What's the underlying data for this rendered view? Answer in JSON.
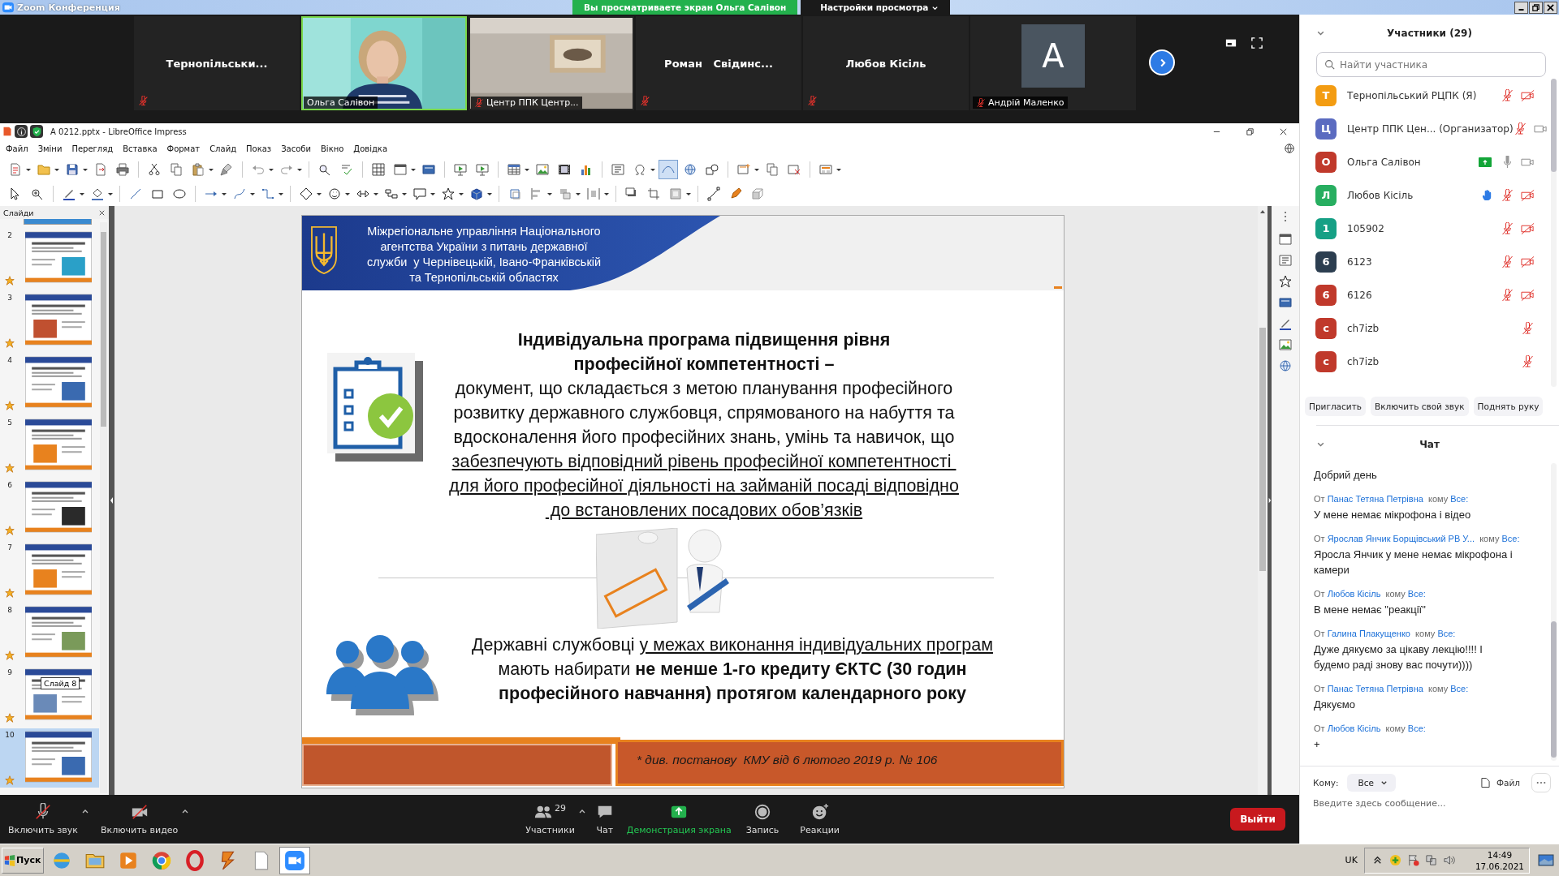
{
  "window": {
    "title": "Zoom Конференция"
  },
  "share_banner": {
    "text": "Вы просматриваете экран Ольга Салівон"
  },
  "view_options": {
    "label": "Настройки просмотра"
  },
  "video_tiles": [
    {
      "kind": "name",
      "name": "Тернопільськи...",
      "muted": true,
      "speaking": false
    },
    {
      "kind": "video",
      "name": "Ольга Салівон",
      "muted": false,
      "speaking": true
    },
    {
      "kind": "video",
      "name": "Центр ППК Центр...",
      "muted": true,
      "speaking": false
    },
    {
      "kind": "name",
      "name": "Роман   Свідинс...",
      "muted": true,
      "speaking": false
    },
    {
      "kind": "name",
      "name": "Любов Кісіль",
      "muted": true,
      "speaking": false
    },
    {
      "kind": "avatar",
      "name": "Андрій Маленко",
      "initial": "A",
      "muted": true,
      "speaking": false
    }
  ],
  "impress": {
    "title": "А 0212.pptx - LibreOffice Impress",
    "menu": [
      "Файл",
      "Зміни",
      "Перегляд",
      "Вставка",
      "Формат",
      "Слайд",
      "Показ",
      "Засоби",
      "Вікно",
      "Довідка"
    ],
    "slides_panel": {
      "title": "Слайди",
      "tooltip": "Слайд 8",
      "slides": [
        {
          "number": "2",
          "selected": false
        },
        {
          "number": "3",
          "selected": false
        },
        {
          "number": "4",
          "selected": false
        },
        {
          "number": "5",
          "selected": false
        },
        {
          "number": "6",
          "selected": false
        },
        {
          "number": "7",
          "selected": false
        },
        {
          "number": "8",
          "selected": false
        },
        {
          "number": "9",
          "selected": false
        },
        {
          "number": "10",
          "selected": true
        }
      ]
    },
    "slide": {
      "header": [
        "Міжрегіональне управління Національного",
        "агентства України з питань державної",
        "служби  у Чернівецькій, Івано-Франківській",
        "та Тернопільській областях"
      ],
      "definition": {
        "title": [
          "Індивідуальна програма підвищення рівня",
          "професійної компетентності –"
        ],
        "body": [
          "документ, що складається з метою планування професійного",
          "розвитку державного службовця, спрямованого на набуття та",
          "вдосконалення його професійних знань, умінь та навичок, що"
        ],
        "underlined": [
          "забезпечують відповідний рівень професійної компетентності ",
          "для його професійної діяльності на займаній посаді відповідно",
          " до встановлених посадових обов’язків"
        ]
      },
      "requirement": {
        "lead": "Державні службовці ",
        "underlined": "у межах виконання індивідуальних програм",
        "lines": [
          "мають набирати **не менше 1-го кредиту ЄКТС (30 годин**",
          "**професійного навчання) протягом календарного року**"
        ]
      },
      "footnote": "* див. постанову  КМУ від 6 лютого 2019 р. № 106"
    }
  },
  "participants": {
    "title": "Участники (29)",
    "search": {
      "placeholder": "Найти участника"
    },
    "people": [
      {
        "initial": "Т",
        "color": "#f39c12",
        "name": "Тернопільський РЦПК (Я)",
        "muted": true,
        "video_off": true,
        "sharing": false,
        "hand_raised": false
      },
      {
        "initial": "Ц",
        "color": "#5b6bc0",
        "name": "Центр ППК Цен... (Организатор)",
        "muted": true,
        "video_off": false,
        "sharing": false,
        "hand_raised": false
      },
      {
        "initial": "О",
        "color": "#c0392b",
        "name": "Ольга Салівон",
        "muted": false,
        "video_off": false,
        "sharing": true,
        "hand_raised": false
      },
      {
        "initial": "Л",
        "color": "#27ae60",
        "name": "Любов Кісіль",
        "muted": true,
        "video_off": true,
        "sharing": false,
        "hand_raised": true
      },
      {
        "initial": "1",
        "color": "#16a085",
        "name": "105902",
        "muted": true,
        "video_off": true,
        "sharing": false,
        "hand_raised": false
      },
      {
        "initial": "6",
        "color": "#2c3e50",
        "name": "6123",
        "muted": true,
        "video_off": true,
        "sharing": false,
        "hand_raised": false
      },
      {
        "initial": "6",
        "color": "#c0392b",
        "name": "6126",
        "muted": true,
        "video_off": true,
        "sharing": false,
        "hand_raised": false
      },
      {
        "initial": "c",
        "color": "#c0392b",
        "name": "ch7izb",
        "muted": true,
        "sharing": false,
        "hand_raised": false
      },
      {
        "initial": "c",
        "color": "#c0392b",
        "name": "ch7izb",
        "muted": true,
        "sharing": false,
        "hand_raised": false
      }
    ],
    "buttons": [
      "Пригласить",
      "Включить свой звук",
      "Поднять руку"
    ]
  },
  "chat": {
    "title": "Чат",
    "messages": [
      {
        "text": "Добрий день"
      },
      {
        "from_label": "От",
        "sender": "Панас Тетяна Петрівна",
        "to_label": "кому",
        "recipient": "Все:",
        "text": "У мене немає мікрофона і відео"
      },
      {
        "from_label": "От",
        "sender": "Ярослав Янчик Борщівський РВ У...",
        "to_label": "кому",
        "recipient": "Все:",
        "text": "Яросла Янчик у мене немає мікрофона і камери"
      },
      {
        "from_label": "От",
        "sender": "Любов Кісіль",
        "to_label": "кому",
        "recipient": "Все:",
        "text": "В мене немає \"реакції\""
      },
      {
        "from_label": "От",
        "sender": "Галина Плакущенко",
        "to_label": "кому",
        "recipient": "Все:",
        "text": "Дуже дякуємо за цікаву лекцію!!!! I будемо раді знову вас почути))))"
      },
      {
        "from_label": "От",
        "sender": "Панас Тетяна Петрівна",
        "to_label": "кому",
        "recipient": "Все:",
        "text": "Дякуємо"
      },
      {
        "from_label": "От",
        "sender": "Любов Кісіль",
        "to_label": "кому",
        "recipient": "Все:",
        "text": "+"
      }
    ],
    "to_label": "Кому:",
    "recipient": "Все",
    "file": "Файл",
    "input": {
      "placeholder": "Введите здесь сообщение..."
    }
  },
  "toolbar": {
    "items": [
      {
        "kind": "mic",
        "label": "Включить звук",
        "caret": true,
        "active": false
      },
      {
        "kind": "camera",
        "label": "Включить видео",
        "caret": true,
        "active": false
      },
      {
        "kind": "participants",
        "label": "Участники",
        "count": "29",
        "caret": true,
        "active": false
      },
      {
        "kind": "chat",
        "label": "Чат",
        "caret": false,
        "active": false
      },
      {
        "kind": "share",
        "label": "Демонстрация экрана",
        "caret": false,
        "active": true
      },
      {
        "kind": "record",
        "label": "Запись",
        "caret": false,
        "active": false
      },
      {
        "kind": "reactions",
        "label": "Реакции",
        "caret": false,
        "active": false
      }
    ],
    "leave": "Выйти"
  },
  "taskbar": {
    "start": "Пуск",
    "apps": [
      {
        "kind": "globe",
        "selected": false
      },
      {
        "kind": "folder",
        "selected": false
      },
      {
        "kind": "player",
        "selected": false
      },
      {
        "kind": "browser",
        "selected": false
      },
      {
        "kind": "ring",
        "selected": false
      },
      {
        "kind": "bolt",
        "selected": false
      },
      {
        "kind": "page",
        "selected": false
      },
      {
        "kind": "video",
        "selected": true
      }
    ],
    "language": "UK",
    "time": "14:49",
    "date": "17.06.2021"
  }
}
